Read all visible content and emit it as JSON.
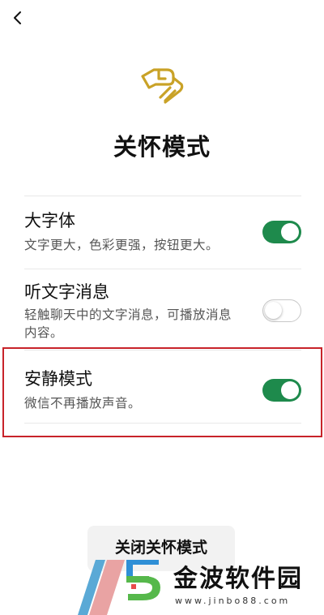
{
  "header": {
    "back_icon": "chevron-left-icon",
    "logo_icon": "care-mode-hand-icon",
    "title": "关怀模式"
  },
  "settings": [
    {
      "title": "大字体",
      "description": "文字更大，色彩更强，按钮更大。",
      "enabled": true
    },
    {
      "title": "听文字消息",
      "description": "轻触聊天中的文字消息，可播放消息内容。",
      "enabled": false
    },
    {
      "title": "安静模式",
      "description": "微信不再播放声音。",
      "enabled": true,
      "highlighted": true
    }
  ],
  "footer": {
    "close_button_label": "关闭关怀模式"
  },
  "watermark": {
    "brand": "金波软件园",
    "url": "www.jinbo88.com"
  },
  "colors": {
    "toggle_on": "#1e8a4c",
    "logo_gold": "#c9a227",
    "highlight_border": "#c8232a"
  }
}
